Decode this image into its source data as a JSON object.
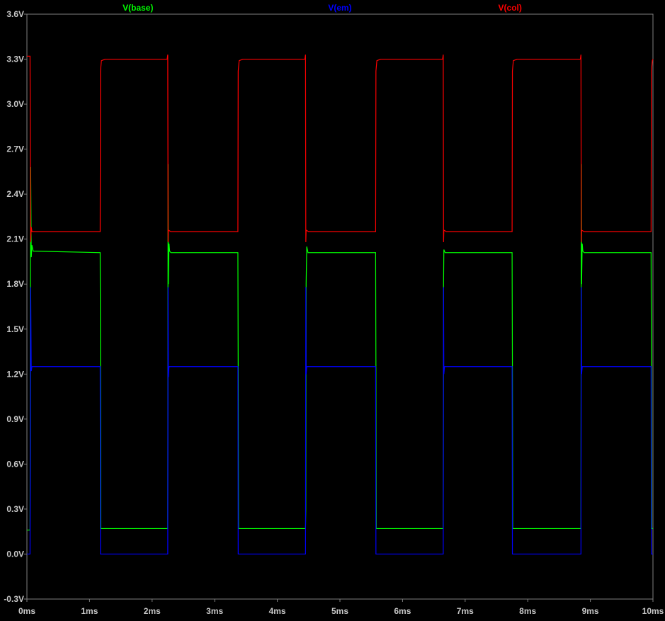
{
  "chart_data": {
    "type": "line",
    "title": "",
    "xlabel": "",
    "ylabel": "",
    "xlim": [
      0,
      10
    ],
    "ylim": [
      -0.3,
      3.6
    ],
    "x_unit": "ms",
    "y_unit": "V",
    "grid": false,
    "legend_position": "top",
    "x_ticks": [
      0,
      1,
      2,
      3,
      4,
      5,
      6,
      7,
      8,
      9,
      10
    ],
    "x_tick_labels": [
      "0ms",
      "1ms",
      "2ms",
      "3ms",
      "4ms",
      "5ms",
      "6ms",
      "7ms",
      "8ms",
      "9ms",
      "10ms"
    ],
    "y_ticks": [
      3.6,
      3.3,
      3.0,
      2.7,
      2.4,
      2.1,
      1.8,
      1.5,
      1.2,
      0.9,
      0.6,
      0.3,
      0.0,
      -0.3
    ],
    "y_tick_labels": [
      "3.6V",
      "3.3V",
      "3.0V",
      "2.7V",
      "2.4V",
      "2.1V",
      "1.8V",
      "1.5V",
      "1.2V",
      "0.9V",
      "0.6V",
      "0.3V",
      "0.0V",
      "-0.3V"
    ],
    "series": [
      {
        "name": "V(base)",
        "color": "#00ff00",
        "x": [
          0,
          0.05,
          0.06,
          0.07,
          0.08,
          0.1,
          1.17,
          1.175,
          1.18,
          2.25,
          2.255,
          2.26,
          2.27,
          2.28,
          2.3,
          3.37,
          3.375,
          3.38,
          4.45,
          4.455,
          4.46,
          4.47,
          4.49,
          5.57,
          5.575,
          5.58,
          6.65,
          6.655,
          6.66,
          6.68,
          7.75,
          7.755,
          7.76,
          8.85,
          8.855,
          8.86,
          8.87,
          8.88,
          8.9,
          9.97,
          9.975,
          9.98,
          10.0
        ],
        "y": [
          0.16,
          0.16,
          2.58,
          1.98,
          2.06,
          2.02,
          2.01,
          1.24,
          0.17,
          0.17,
          2.6,
          1.8,
          2.07,
          2.02,
          2.01,
          2.01,
          1.24,
          0.17,
          0.17,
          0.3,
          1.8,
          2.05,
          2.01,
          2.01,
          1.24,
          0.17,
          0.17,
          1.8,
          2.03,
          2.01,
          2.01,
          1.24,
          0.17,
          0.17,
          2.6,
          1.8,
          2.07,
          2.02,
          2.01,
          2.01,
          1.24,
          0.17,
          0.17
        ]
      },
      {
        "name": "V(em)",
        "color": "#0000ff",
        "x": [
          0,
          0.05,
          0.06,
          0.07,
          0.08,
          1.17,
          1.175,
          1.18,
          2.25,
          2.255,
          2.26,
          2.27,
          2.28,
          3.37,
          3.375,
          3.38,
          4.45,
          4.455,
          4.46,
          4.47,
          5.57,
          5.575,
          5.58,
          6.65,
          6.655,
          6.66,
          6.67,
          7.75,
          7.755,
          7.76,
          8.85,
          8.855,
          8.86,
          8.87,
          9.97,
          9.975,
          9.98,
          10.0
        ],
        "y": [
          0.0,
          0.0,
          1.78,
          1.22,
          1.25,
          1.25,
          0.0,
          0.0,
          0.0,
          1.78,
          1.18,
          1.25,
          1.25,
          1.25,
          0.0,
          0.0,
          0.0,
          1.78,
          1.2,
          1.25,
          1.25,
          0.0,
          0.0,
          0.0,
          1.78,
          1.2,
          1.25,
          1.25,
          0.0,
          0.0,
          0.0,
          1.78,
          1.2,
          1.25,
          1.25,
          0.0,
          0.0,
          0.0
        ]
      },
      {
        "name": "V(col)",
        "color": "#ff0000",
        "x": [
          0,
          0.05,
          0.06,
          0.07,
          0.08,
          1.17,
          1.175,
          1.19,
          1.25,
          2.24,
          2.25,
          2.255,
          2.26,
          2.3,
          3.37,
          3.375,
          3.39,
          3.45,
          4.44,
          4.45,
          4.455,
          4.46,
          4.5,
          5.57,
          5.575,
          5.59,
          5.65,
          6.64,
          6.65,
          6.655,
          6.66,
          6.7,
          7.75,
          7.755,
          7.77,
          7.83,
          8.84,
          8.85,
          8.855,
          8.86,
          8.9,
          9.97,
          9.975,
          9.99,
          10.0
        ],
        "y": [
          3.32,
          3.32,
          2.08,
          2.18,
          2.15,
          2.15,
          3.22,
          3.29,
          3.3,
          3.3,
          3.33,
          2.08,
          2.16,
          2.15,
          2.15,
          3.22,
          3.29,
          3.3,
          3.3,
          3.33,
          2.08,
          2.16,
          2.15,
          2.15,
          3.22,
          3.29,
          3.3,
          3.3,
          3.33,
          2.08,
          2.16,
          2.15,
          2.15,
          3.22,
          3.29,
          3.3,
          3.3,
          3.33,
          2.08,
          2.16,
          2.15,
          2.15,
          3.22,
          3.29,
          3.3
        ]
      }
    ]
  }
}
